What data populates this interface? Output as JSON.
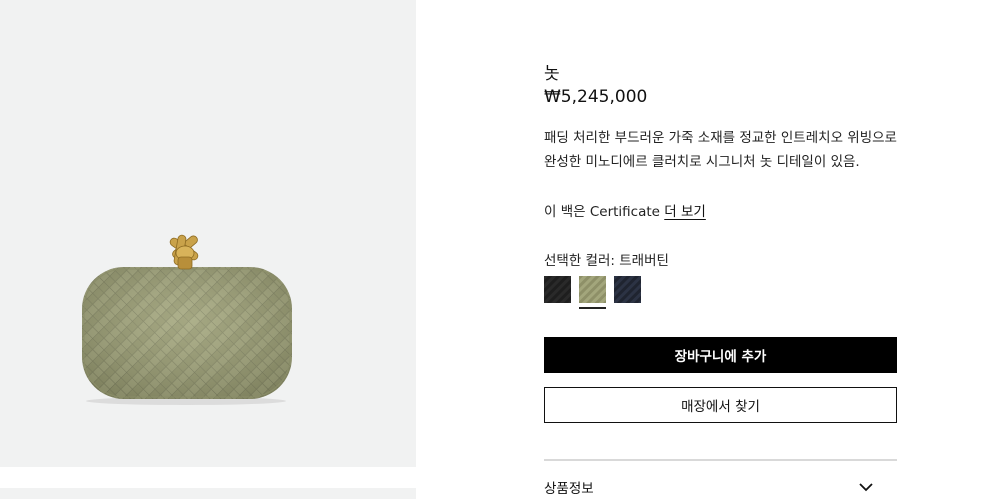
{
  "product": {
    "name": "놋",
    "price": "₩5,245,000",
    "description": "패딩 처리한 부드러운 가죽 소재를 정교한 인트레치오 위빙으로 완성한 미노디에르 클러치로 시그니처 놋 디테일이 있음.",
    "certificate_prefix": "이 백은 Certificate",
    "certificate_link": "더 보기"
  },
  "color": {
    "label": "선택한 컬러: 트래버틴",
    "swatches": [
      {
        "name": "black",
        "hex": "#1e1e1e"
      },
      {
        "name": "travertine",
        "hex": "#9a9a70",
        "selected": true
      },
      {
        "name": "navy",
        "hex": "#1f2430"
      }
    ]
  },
  "actions": {
    "add_to_cart": "장바구니에 추가",
    "find_in_store": "매장에서 찾기"
  },
  "accordion": {
    "product_info": "상품정보"
  },
  "icons": {
    "accordion_toggle": "chevron-down-icon"
  },
  "colors": {
    "gallery_bg": "#f1f2f2",
    "bag": "#a3a67c",
    "knot": "#c9a24a"
  }
}
